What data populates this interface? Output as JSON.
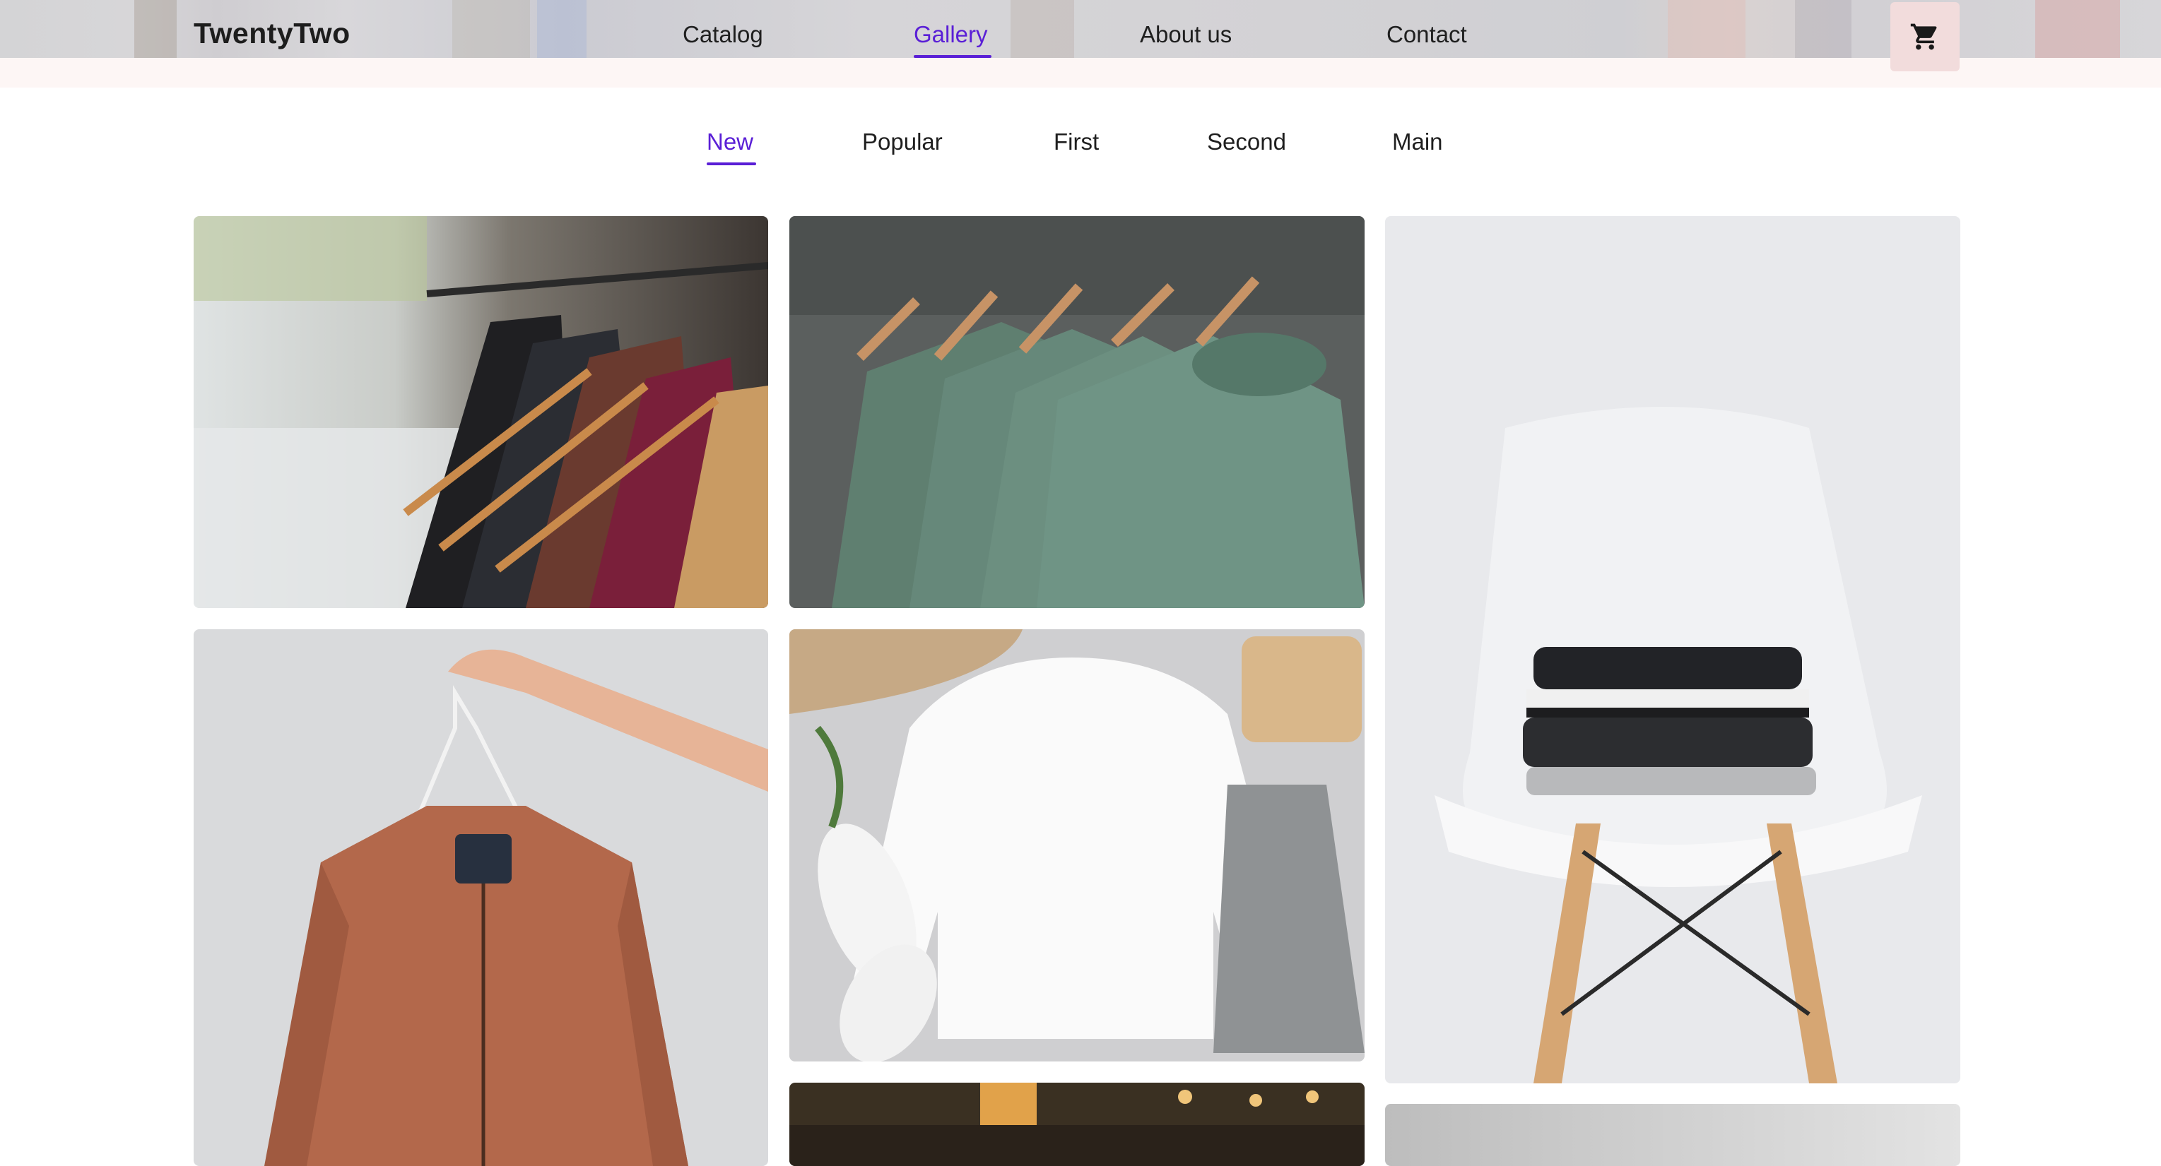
{
  "header": {
    "logo": "TwentyTwo",
    "nav": [
      {
        "label": "Catalog",
        "active": false
      },
      {
        "label": "Gallery",
        "active": true
      },
      {
        "label": "About us",
        "active": false
      },
      {
        "label": "Contact",
        "active": false
      }
    ],
    "cart_icon": "shopping-cart-icon"
  },
  "tabs": [
    {
      "label": "New",
      "active": true
    },
    {
      "label": "Popular",
      "active": false
    },
    {
      "label": "First",
      "active": false
    },
    {
      "label": "Second",
      "active": false
    },
    {
      "label": "Main",
      "active": false
    }
  ],
  "gallery": [
    {
      "name": "clothing-rack-photo"
    },
    {
      "name": "green-tshirts-photo"
    },
    {
      "name": "folded-clothes-chair-photo"
    },
    {
      "name": "brown-jacket-hanger-photo"
    },
    {
      "name": "white-sweatshirt-flatlay-photo"
    },
    {
      "name": "store-interior-photo"
    },
    {
      "name": "grey-photo"
    }
  ],
  "colors": {
    "accent": "#5a1fd6",
    "cart_bg": "#f2dcdc",
    "header_bg": "#d4d3d6"
  }
}
